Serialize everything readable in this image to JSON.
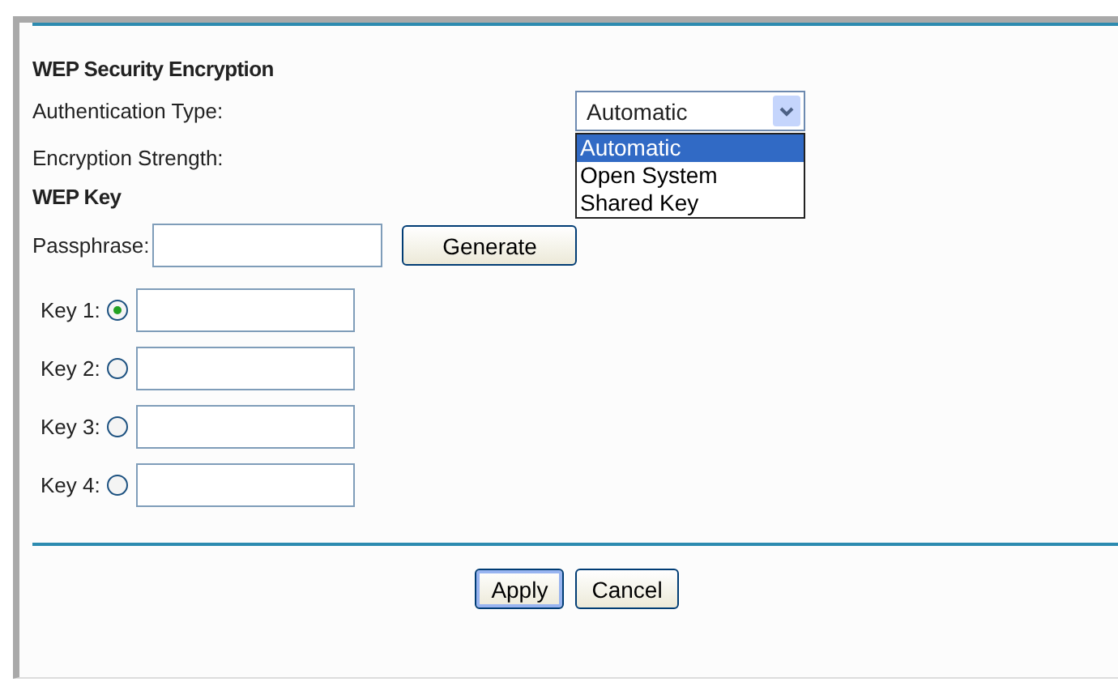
{
  "section_title": "WEP Security Encryption",
  "authentication_type": {
    "label": "Authentication Type:",
    "value": "Automatic",
    "expanded": true,
    "options": [
      {
        "label": "Automatic",
        "selected": true
      },
      {
        "label": "Open System",
        "selected": false
      },
      {
        "label": "Shared Key",
        "selected": false
      }
    ]
  },
  "encryption_strength": {
    "label": "Encryption Strength:"
  },
  "wep_key": {
    "title": "WEP Key",
    "passphrase_label": "Passphrase:",
    "generate_button": "Generate",
    "keys": [
      {
        "label": "Key 1:",
        "selected": true
      },
      {
        "label": "Key 2:",
        "selected": false
      },
      {
        "label": "Key 3:",
        "selected": false
      },
      {
        "label": "Key 4:",
        "selected": false
      }
    ]
  },
  "buttons": [
    {
      "label": "Apply",
      "default": true
    },
    {
      "label": "Cancel",
      "default": false
    }
  ]
}
